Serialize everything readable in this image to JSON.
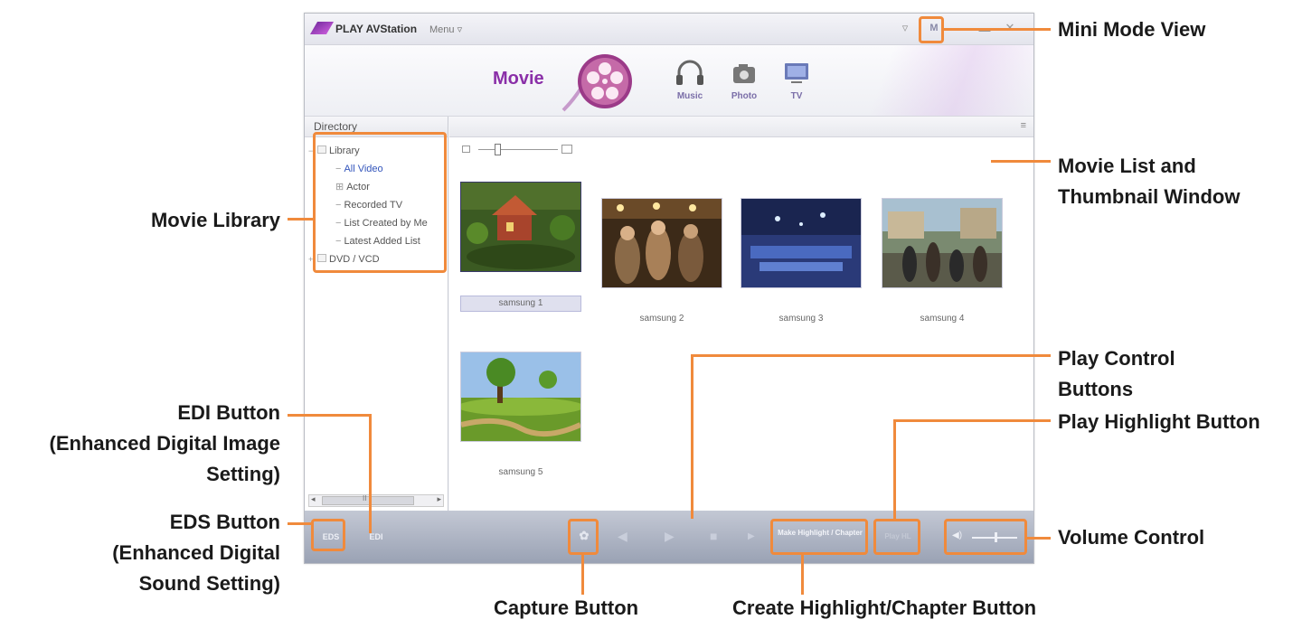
{
  "window": {
    "app_name": "PLAY AVStation",
    "menu_label": "Menu ▿",
    "filter_icon": "▿",
    "mini_mode_label": "M",
    "minimize_label": "▬",
    "close_label": "✕"
  },
  "media_tabs": {
    "active": "Movie",
    "items": [
      {
        "label": "Music",
        "icon": "headphones-icon"
      },
      {
        "label": "Photo",
        "icon": "camera-icon"
      },
      {
        "label": "TV",
        "icon": "tv-icon"
      }
    ]
  },
  "directory": {
    "header": "Directory",
    "tree": [
      {
        "label": "Library",
        "level": 0
      },
      {
        "label": "All Video",
        "level": 1
      },
      {
        "label": "Actor",
        "level": 1
      },
      {
        "label": "Recorded TV",
        "level": 1
      },
      {
        "label": "List Created by Me",
        "level": 1
      },
      {
        "label": "Latest Added List",
        "level": 1
      },
      {
        "label": "DVD / VCD",
        "level": 0
      }
    ],
    "scroll_mid": "II",
    "scroll_left": "◂",
    "scroll_right": "▸"
  },
  "main": {
    "menu_icon": "≡",
    "thumbnails": [
      {
        "caption": "samsung 1",
        "selected": true
      },
      {
        "caption": "samsung 2",
        "selected": false
      },
      {
        "caption": "samsung 3",
        "selected": false
      },
      {
        "caption": "samsung 4",
        "selected": false
      },
      {
        "caption": "samsung 5",
        "selected": false
      }
    ]
  },
  "controls": {
    "eds_label": "EDS",
    "edi_label": "EDI",
    "capture_icon": "✿",
    "prev_icon": "◀",
    "play_icon": "▶",
    "stop_icon": "■",
    "next_icon": "▶",
    "make_label": "Make Highlight / Chapter",
    "play_highlight_label": "Play HL",
    "volume_icon": "◀)",
    "volume_level": 0.5
  },
  "callouts": {
    "mini_mode": "Mini Mode View",
    "movie_list_1": "Movie List and",
    "movie_list_2": "Thumbnail Window",
    "movie_library": "Movie Library",
    "play_control_1": "Play Control",
    "play_control_2": "Buttons",
    "play_highlight": "Play Highlight Button",
    "volume": "Volume Control",
    "edi_1": "EDI Button",
    "edi_2": "(Enhanced Digital Image",
    "edi_3": "Setting)",
    "eds_1": "EDS Button",
    "eds_2": "(Enhanced Digital",
    "eds_3": "Sound Setting)",
    "capture": "Capture Button",
    "create_highlight": "Create Highlight/Chapter Button"
  },
  "colors": {
    "accent": "#f08a3c",
    "brand_purple": "#8a2fa8",
    "control_bar": "#a9b0c0"
  }
}
